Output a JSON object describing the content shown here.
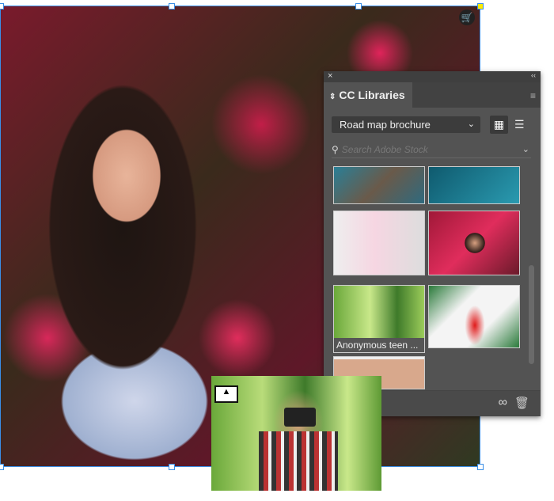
{
  "panel": {
    "close_label": "×",
    "collapse_label": "‹‹",
    "tab_label": "CC Libraries",
    "tab_arrows": "⇕",
    "menu_icon": "≡",
    "library_select": "Road map brochure",
    "search_placeholder": "Search Adobe Stock",
    "thumbnail_caption": "Anonymous teen ..."
  },
  "colors": {
    "selection": "#3a8ee6",
    "panel_bg": "#535353"
  }
}
